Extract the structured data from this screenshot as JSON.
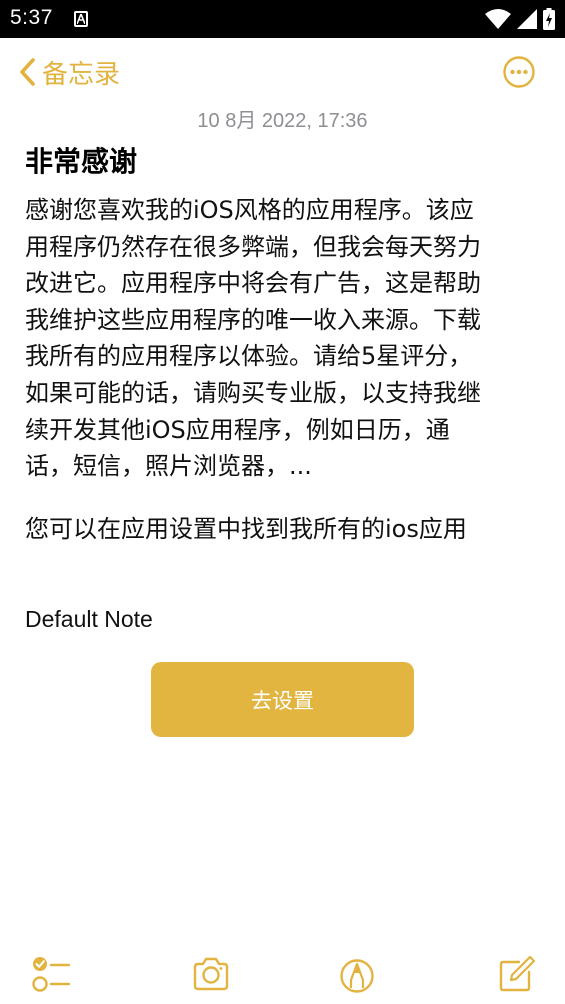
{
  "status_bar": {
    "time": "5:37",
    "icons": [
      "notification-a-icon",
      "wifi-icon",
      "signal-icon",
      "battery-icon"
    ]
  },
  "nav": {
    "back_label": "备忘录",
    "more_icon": "ellipsis-circle-icon",
    "accent_color": "#e2b33f"
  },
  "note": {
    "date": "10 8月 2022, 17:36",
    "title": "非常感谢",
    "lines": [
      "感谢您喜欢我的iOS风格的应用程序。该应",
      "用程序仍然存在很多弊端，但我会每天努力",
      "改进它。应用程序中将会有广告，这是帮助",
      "我维护这些应用程序的唯一收入来源。下载",
      "我所有的应用程序以体验。请给5星评分，",
      "如果可能的话，请购买专业版，以支持我继",
      "续开发其他iOS应用程序，例如日历，通",
      "话，短信，照片浏览器，..."
    ],
    "paragraph2": "您可以在应用设置中找到我所有的ios应用",
    "default_note": "Default Note"
  },
  "settings_button": {
    "label": "去设置",
    "color": "#e2b540"
  },
  "toolbar": {
    "icons": [
      "checklist-icon",
      "camera-icon",
      "markup-icon",
      "compose-icon"
    ]
  }
}
